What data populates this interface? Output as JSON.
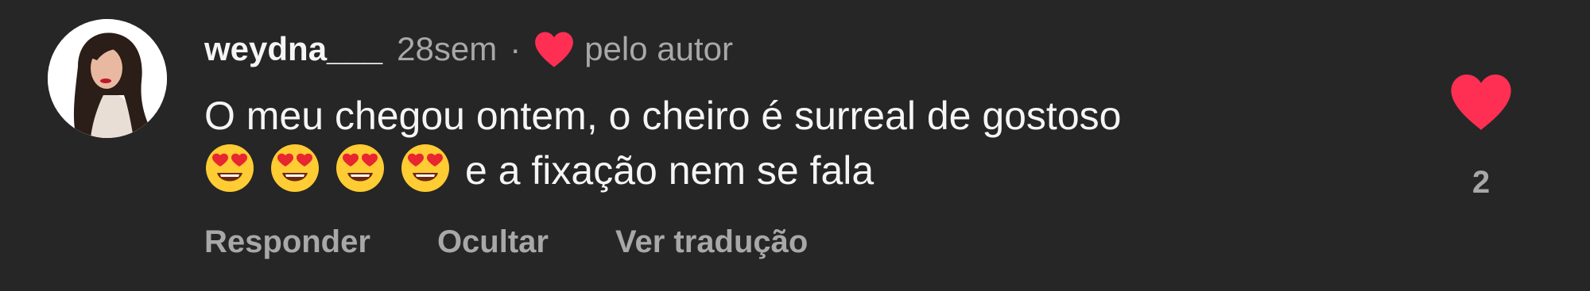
{
  "comment": {
    "username": "weydna___",
    "time": "28sem",
    "separator": "·",
    "author_liked_text": "pelo autor",
    "text_line1": "O meu chegou ontem, o cheiro é surreal de gostoso",
    "emoji_icons": [
      "heart-eyes-emoji",
      "heart-eyes-emoji",
      "heart-eyes-emoji",
      "heart-eyes-emoji"
    ],
    "text_line2_tail": "e a fixação nem se fala",
    "actions": {
      "reply": "Responder",
      "hide": "Ocultar",
      "translate": "Ver tradução"
    },
    "like_count": "2"
  },
  "colors": {
    "background": "#262626",
    "primary_text": "#f5f5f5",
    "secondary_text": "#a8a8a8",
    "heart": "#ff2f54"
  }
}
